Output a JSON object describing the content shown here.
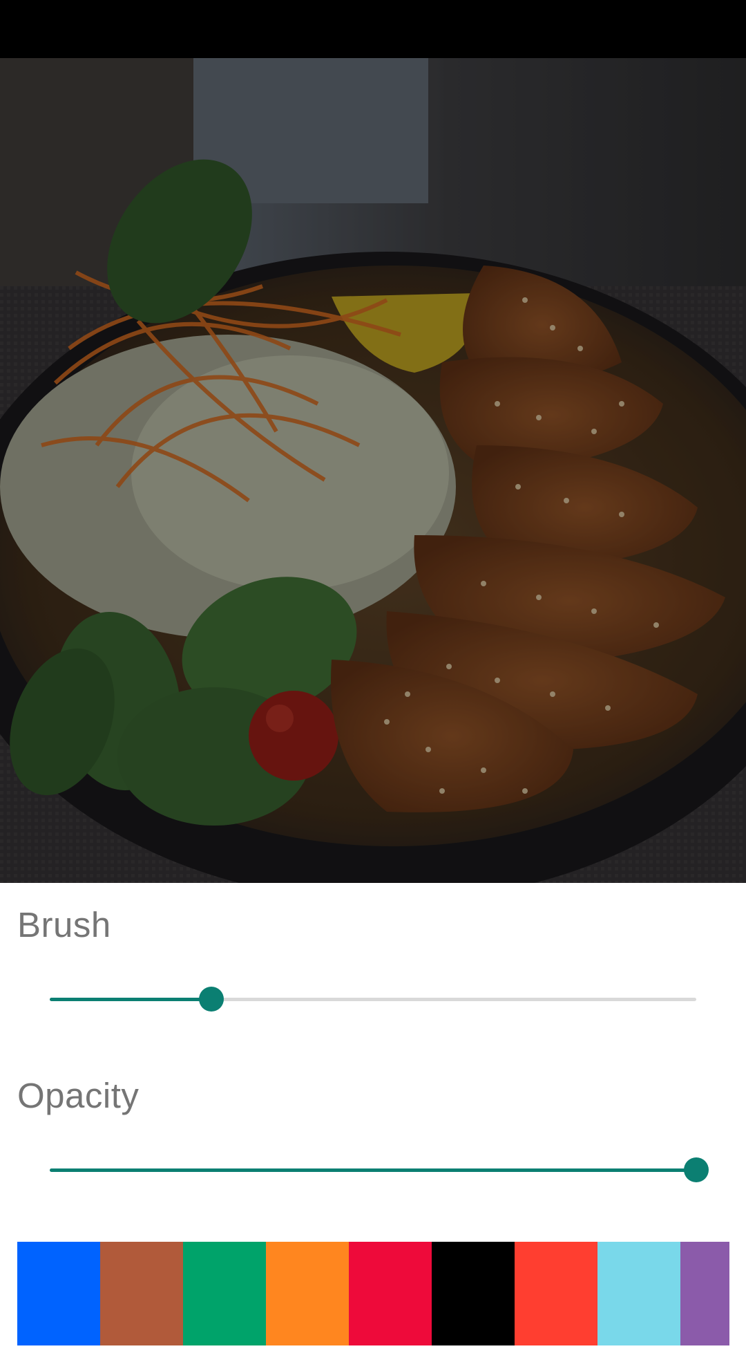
{
  "screen": {
    "photo_icon": "food-photo-image"
  },
  "brush": {
    "label": "Brush",
    "value": 0.25
  },
  "opacity": {
    "label": "Opacity",
    "value": 1.0
  },
  "palette": {
    "colors": [
      "#0063FF",
      "#B15A3A",
      "#00A36A",
      "#FF861F",
      "#EE0A3A",
      "#000000",
      "#FF3E30",
      "#79D8EA",
      "#8B5BAA"
    ]
  }
}
